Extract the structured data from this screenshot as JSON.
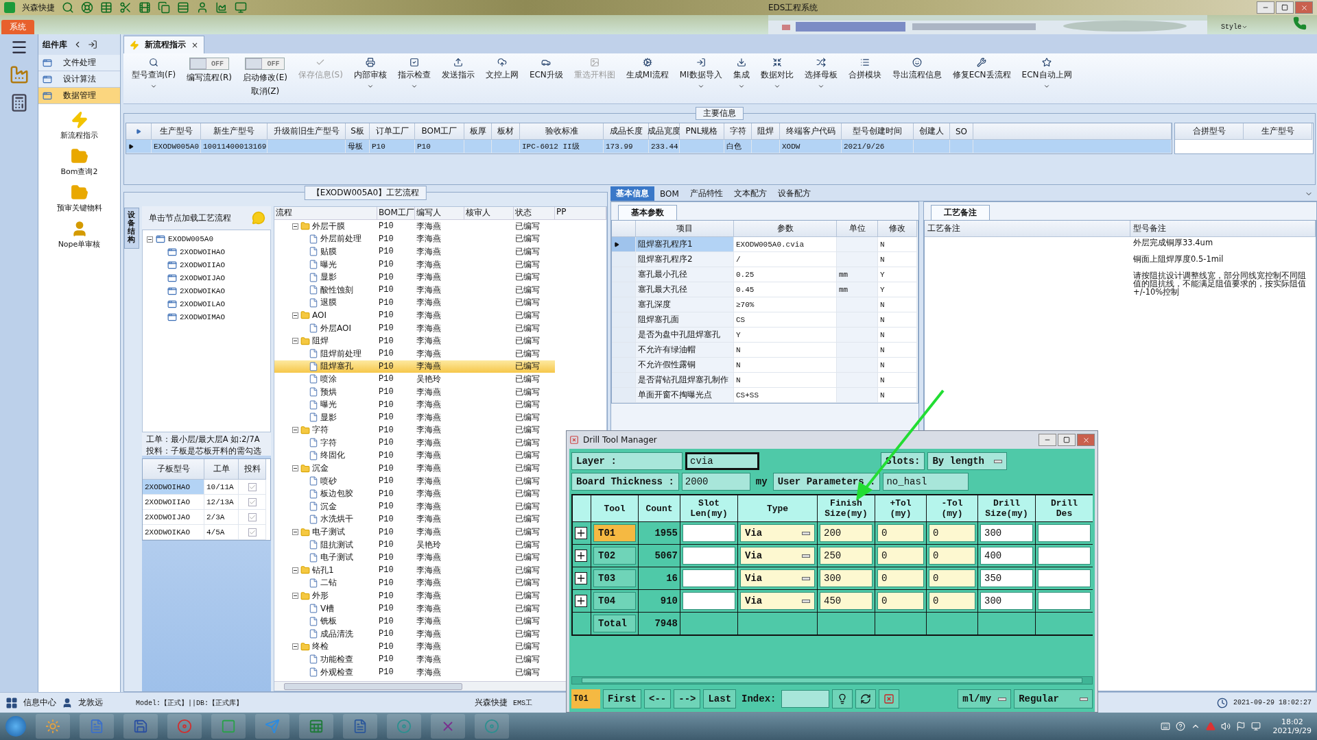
{
  "title_bar": {
    "app_name": "兴森快捷",
    "title": "EDS工程系统"
  },
  "ribbon_tabs": [
    {
      "label": "系统",
      "selected": true
    }
  ],
  "style_menu": "Style",
  "nav_panel": {
    "title": "组件库",
    "groups": [
      {
        "label": "文件处理",
        "selected": false
      },
      {
        "label": "设计算法",
        "selected": false
      },
      {
        "label": "数据管理",
        "selected": true
      }
    ],
    "tools": [
      "新流程指示",
      "Bom查询2",
      "预审关键物料",
      "Nope单审核"
    ]
  },
  "doc_tab": {
    "label": "新流程指示",
    "close": "×"
  },
  "toolbar": [
    {
      "kind": "button",
      "label": "型号查询(F)",
      "disabled": false,
      "dropdown": true
    },
    {
      "kind": "toggle",
      "label": "编写流程(R)",
      "state": "OFF",
      "on": false
    },
    {
      "kind": "toggle",
      "label": "启动修改(E)",
      "label_2": "取消(Z)",
      "state": "OFF",
      "on": false
    },
    {
      "kind": "button",
      "label": "保存信息(S)",
      "disabled": true,
      "dropdown": false
    },
    {
      "kind": "button",
      "label": "内部审核",
      "disabled": false,
      "dropdown": true
    },
    {
      "kind": "button",
      "label": "指示检查",
      "disabled": false,
      "dropdown": true
    },
    {
      "kind": "button",
      "label": "发送指示",
      "disabled": false,
      "dropdown": false
    },
    {
      "kind": "button",
      "label": "文控上网",
      "disabled": false,
      "dropdown": false
    },
    {
      "kind": "button",
      "label": "ECN升级",
      "disabled": false,
      "dropdown": false
    },
    {
      "kind": "button",
      "label": "重选开料图",
      "disabled": true,
      "dropdown": false
    },
    {
      "kind": "button",
      "label": "生成MI流程",
      "disabled": false,
      "dropdown": false
    },
    {
      "kind": "button",
      "label": "MI数据导入",
      "disabled": false,
      "dropdown": true
    },
    {
      "kind": "button",
      "label": "集成",
      "disabled": false,
      "dropdown": true
    },
    {
      "kind": "button",
      "label": "数据对比",
      "disabled": false,
      "dropdown": true
    },
    {
      "kind": "button",
      "label": "选择母板",
      "disabled": false,
      "dropdown": true
    },
    {
      "kind": "button",
      "label": "合拼模块",
      "disabled": false,
      "dropdown": false
    },
    {
      "kind": "button",
      "label": "导出流程信息",
      "disabled": false,
      "dropdown": false
    },
    {
      "kind": "button",
      "label": "修复ECN丢流程",
      "disabled": false,
      "dropdown": false
    },
    {
      "kind": "button",
      "label": "ECN自动上网",
      "disabled": false,
      "dropdown": true
    }
  ],
  "main_info": {
    "title": "主要信息",
    "columns": [
      "生产型号",
      "新生产型号",
      "升级前旧生产型号",
      "S板",
      "订单工厂",
      "BOM工厂",
      "板厚",
      "板材",
      "验收标准",
      "成品长度",
      "成品宽度",
      "PNL规格",
      "字符",
      "阻焊",
      "终端客户代码",
      "型号创建时间",
      "创建人",
      "SO"
    ],
    "rows": [
      {
        "selected": true,
        "cells": [
          "EXODW005A0",
          "10011400013169",
          null,
          "母板",
          "P10",
          "P10",
          null,
          null,
          "IPC-6012 II级",
          "173.99",
          "233.44",
          null,
          "白色",
          null,
          "XODW",
          "2021/9/26",
          null,
          null
        ]
      }
    ],
    "side_columns": [
      "合拼型号",
      "生产型号"
    ]
  },
  "process_panel": {
    "title": "【EXODW005A0】工艺流程",
    "side_tab": "设备结构",
    "hint": "单击节点加载工艺流程",
    "tree": {
      "label": "EXODW005A0",
      "expanded": true,
      "children": [
        {
          "label": "2XODWOIHAO"
        },
        {
          "label": "2XODWOIIAO"
        },
        {
          "label": "2XODWOIJAO"
        },
        {
          "label": "2XODWOIKAO"
        },
        {
          "label": "2XODWOILAO"
        },
        {
          "label": "2XODWOIMAO"
        }
      ]
    },
    "notes": [
      "工单：最小层/最大层A 如:2/7A",
      "投料：子板是芯板开料的需勾选"
    ],
    "sub_columns": [
      "子板型号",
      "工单",
      "投料"
    ],
    "sub_rows": [
      {
        "board": "2XODWOIHAO",
        "order": "10/11A",
        "checked": true,
        "selected": true
      },
      {
        "board": "2XODWOIIAO",
        "order": "12/13A",
        "checked": true,
        "selected": false
      },
      {
        "board": "2XODWOIJAO",
        "order": "2/3A",
        "checked": true,
        "selected": false
      },
      {
        "board": "2XODWOIKAO",
        "order": "4/5A",
        "checked": true,
        "selected": false
      }
    ],
    "flow_columns": [
      "流程",
      "BOM工厂",
      "编写人",
      "核审人",
      "状态",
      "PP"
    ],
    "flow": [
      {
        "name": "外层干膜",
        "bom": "P10",
        "writer": "李海燕",
        "status": "已编写",
        "expanded": true,
        "selected": false,
        "children": [
          {
            "name": "外层前处理",
            "bom": "P10",
            "writer": "李海燕",
            "status": "已编写",
            "selected": false
          },
          {
            "name": "贴膜",
            "bom": "P10",
            "writer": "李海燕",
            "status": "已编写",
            "selected": false
          },
          {
            "name": "曝光",
            "bom": "P10",
            "writer": "李海燕",
            "status": "已编写",
            "selected": false
          },
          {
            "name": "显影",
            "bom": "P10",
            "writer": "李海燕",
            "status": "已编写",
            "selected": false
          },
          {
            "name": "酸性蚀刻",
            "bom": "P10",
            "writer": "李海燕",
            "status": "已编写",
            "selected": false
          },
          {
            "name": "退膜",
            "bom": "P10",
            "writer": "李海燕",
            "status": "已编写",
            "selected": false
          }
        ]
      },
      {
        "name": "AOI",
        "bom": "P10",
        "writer": "李海燕",
        "status": "已编写",
        "expanded": true,
        "selected": false,
        "children": [
          {
            "name": "外层AOI",
            "bom": "P10",
            "writer": "李海燕",
            "status": "已编写",
            "selected": false
          }
        ]
      },
      {
        "name": "阻焊",
        "bom": "P10",
        "writer": "李海燕",
        "status": "已编写",
        "expanded": true,
        "selected": false,
        "children": [
          {
            "name": "阻焊前处理",
            "bom": "P10",
            "writer": "李海燕",
            "status": "已编写",
            "selected": false
          },
          {
            "name": "阻焊塞孔",
            "bom": "P10",
            "writer": "李海燕",
            "status": "已编写",
            "selected": true
          },
          {
            "name": "喷涂",
            "bom": "P10",
            "writer": "吴艳玲",
            "status": "已编写",
            "selected": false
          },
          {
            "name": "预烘",
            "bom": "P10",
            "writer": "李海燕",
            "status": "已编写",
            "selected": false
          },
          {
            "name": "曝光",
            "bom": "P10",
            "writer": "李海燕",
            "status": "已编写",
            "selected": false
          },
          {
            "name": "显影",
            "bom": "P10",
            "writer": "李海燕",
            "status": "已编写",
            "selected": false
          }
        ]
      },
      {
        "name": "字符",
        "bom": "P10",
        "writer": "李海燕",
        "status": "已编写",
        "expanded": true,
        "selected": false,
        "children": [
          {
            "name": "字符",
            "bom": "P10",
            "writer": "李海燕",
            "status": "已编写",
            "selected": false
          },
          {
            "name": "终固化",
            "bom": "P10",
            "writer": "李海燕",
            "status": "已编写",
            "selected": false
          }
        ]
      },
      {
        "name": "沉金",
        "bom": "P10",
        "writer": "李海燕",
        "status": "已编写",
        "expanded": true,
        "selected": false,
        "children": [
          {
            "name": "喷砂",
            "bom": "P10",
            "writer": "李海燕",
            "status": "已编写",
            "selected": false
          },
          {
            "name": "板边包胶",
            "bom": "P10",
            "writer": "李海燕",
            "status": "已编写",
            "selected": false
          },
          {
            "name": "沉金",
            "bom": "P10",
            "writer": "李海燕",
            "status": "已编写",
            "selected": false
          },
          {
            "name": "水洗烘干",
            "bom": "P10",
            "writer": "李海燕",
            "status": "已编写",
            "selected": false
          }
        ]
      },
      {
        "name": "电子测试",
        "bom": "P10",
        "writer": "李海燕",
        "status": "已编写",
        "expanded": true,
        "selected": false,
        "children": [
          {
            "name": "阻抗测试",
            "bom": "P10",
            "writer": "吴艳玲",
            "status": "已编写",
            "selected": false
          },
          {
            "name": "电子测试",
            "bom": "P10",
            "writer": "李海燕",
            "status": "已编写",
            "selected": false
          }
        ]
      },
      {
        "name": "钻孔1",
        "bom": "P10",
        "writer": "李海燕",
        "status": "已编写",
        "expanded": true,
        "selected": false,
        "children": [
          {
            "name": "二钻",
            "bom": "P10",
            "writer": "李海燕",
            "status": "已编写",
            "selected": false
          }
        ]
      },
      {
        "name": "外形",
        "bom": "P10",
        "writer": "李海燕",
        "status": "已编写",
        "expanded": true,
        "selected": false,
        "children": [
          {
            "name": "V槽",
            "bom": "P10",
            "writer": "李海燕",
            "status": "已编写",
            "selected": false
          },
          {
            "name": "铣板",
            "bom": "P10",
            "writer": "李海燕",
            "status": "已编写",
            "selected": false
          },
          {
            "name": "成品清洗",
            "bom": "P10",
            "writer": "李海燕",
            "status": "已编写",
            "selected": false
          }
        ]
      },
      {
        "name": "终检",
        "bom": "P10",
        "writer": "李海燕",
        "status": "已编写",
        "expanded": true,
        "selected": false,
        "children": [
          {
            "name": "功能检查",
            "bom": "P10",
            "writer": "李海燕",
            "status": "已编写",
            "selected": false
          },
          {
            "name": "外观检查",
            "bom": "P10",
            "writer": "李海燕",
            "status": "已编写",
            "selected": false
          }
        ]
      }
    ]
  },
  "info_tabs": [
    {
      "label": "基本信息",
      "selected": true
    },
    {
      "label": "BOM",
      "selected": false
    },
    {
      "label": "产品特性",
      "selected": false
    },
    {
      "label": "文本配方",
      "selected": false
    },
    {
      "label": "设备配方",
      "selected": false
    }
  ],
  "params": {
    "tab": "基本参数",
    "columns": [
      "项目",
      "参数",
      "单位",
      "修改"
    ],
    "rows": [
      {
        "item": "阻焊塞孔程序1",
        "value": "EXODW005A0.cvia",
        "modified": "N",
        "selected": true
      },
      {
        "item": "阻焊塞孔程序2",
        "value": "/",
        "modified": "N",
        "selected": false
      },
      {
        "item": "塞孔最小孔径",
        "value": "0.25",
        "unit": "mm",
        "modified": "Y",
        "selected": false
      },
      {
        "item": "塞孔最大孔径",
        "value": "0.45",
        "unit": "mm",
        "modified": "Y",
        "selected": false
      },
      {
        "item": "塞孔深度",
        "value": "≥70%",
        "modified": "N",
        "selected": false
      },
      {
        "item": "阻焊塞孔面",
        "value": "CS",
        "modified": "N",
        "selected": false
      },
      {
        "item": "是否为盘中孔阻焊塞孔",
        "value": "Y",
        "modified": "N",
        "selected": false
      },
      {
        "item": "不允许有绿油帽",
        "value": "N",
        "modified": "N",
        "selected": false
      },
      {
        "item": "不允许假性露铜",
        "value": "N",
        "modified": "N",
        "selected": false
      },
      {
        "item": "是否背钻孔阻焊塞孔制作",
        "value": "N",
        "modified": "N",
        "selected": false
      },
      {
        "item": "单面开窗不掏曝光点",
        "value": "CS+SS",
        "modified": "N",
        "selected": false
      }
    ]
  },
  "remarks": {
    "tab": "工艺备注",
    "columns": [
      "工艺备注",
      "型号备注"
    ],
    "model_notes": [
      "外层完成铜厚33.4um",
      "铜面上阻焊厚度0.5-1mil",
      "请按阻抗设计调整线宽，部分同线宽控制不同阻值的阻抗线，不能满足阻值要求的，按实际阻值+/-10%控制"
    ]
  },
  "drill_tool_manager": {
    "title": "Drill Tool Manager",
    "layer_label": "Layer :",
    "layer": "cvia",
    "slots_label": "Slots:",
    "slots": "By length",
    "thickness_label": "Board Thickness :",
    "thickness": "2000",
    "thickness_unit": "my",
    "user_params_label": "User Parameters :",
    "user_params": "no_hasl",
    "columns": [
      "Tool",
      "Count",
      "Slot\nLen(my)",
      "Type",
      "Finish\nSize(my)",
      "+Tol\n(my)",
      "-Tol\n(my)",
      "Drill\nSize(my)",
      "Drill\nDes"
    ],
    "rows": [
      {
        "tool": "T01",
        "count": "1955",
        "type": "Via",
        "finish": "200",
        "plus_tol": "0",
        "minus_tol": "0",
        "drill": "300",
        "selected": true
      },
      {
        "tool": "T02",
        "count": "5067",
        "type": "Via",
        "finish": "250",
        "plus_tol": "0",
        "minus_tol": "0",
        "drill": "400",
        "selected": false
      },
      {
        "tool": "T03",
        "count": "16",
        "type": "Via",
        "finish": "300",
        "plus_tol": "0",
        "minus_tol": "0",
        "drill": "350",
        "selected": false
      },
      {
        "tool": "T04",
        "count": "910",
        "type": "Via",
        "finish": "450",
        "plus_tol": "0",
        "minus_tol": "0",
        "drill": "300",
        "selected": false
      }
    ],
    "total_label": "Total",
    "total": "7948",
    "current_tool": "T01",
    "nav": [
      "First",
      "<--",
      "-->",
      "Last"
    ],
    "index_label": "Index:",
    "units": "ml/my",
    "mode": "Regular"
  },
  "status_bar": {
    "info_center": "信息中心",
    "user": "龙敦远",
    "model": "Model:【正式】||DB:【正式库】",
    "company": "兴森快捷",
    "system": "EMS工",
    "datetime": "2021-09-29 18:02:27"
  },
  "taskbar": {
    "time": "18:02",
    "date": "2021/9/29"
  }
}
